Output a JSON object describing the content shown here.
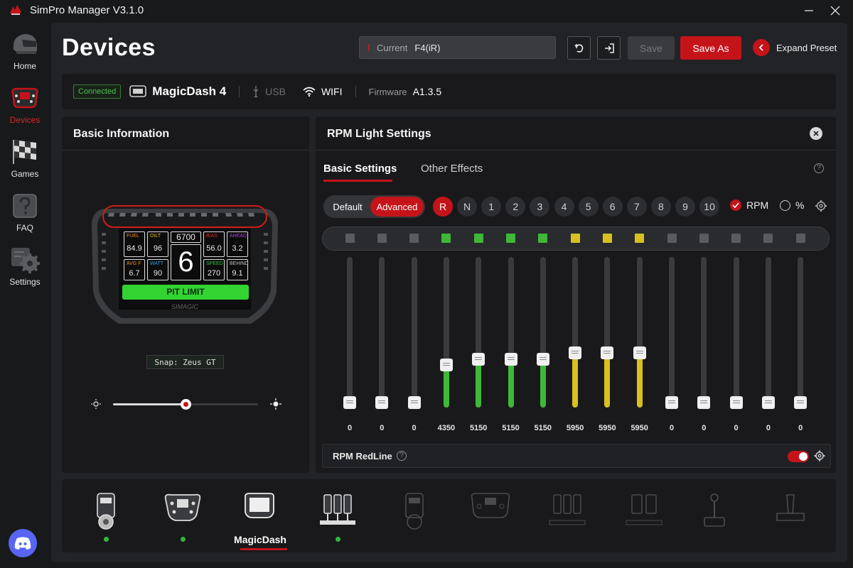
{
  "app": {
    "title": "SimPro Manager V3.1.0"
  },
  "sidebar": {
    "items": [
      {
        "label": "Home",
        "icon": "helmet-icon"
      },
      {
        "label": "Devices",
        "icon": "steering-wheel-icon"
      },
      {
        "label": "Games",
        "icon": "checkered-flag-icon"
      },
      {
        "label": "FAQ",
        "icon": "question-icon"
      },
      {
        "label": "Settings",
        "icon": "gear-icon"
      }
    ]
  },
  "header": {
    "title": "Devices",
    "preset_label": "Current",
    "preset_value": "F4(iR)",
    "save_label": "Save",
    "save_as_label": "Save As",
    "expand_label": "Expand Preset"
  },
  "device": {
    "status": "Connected",
    "name": "MagicDash 4",
    "usb": "USB",
    "wifi": "WIFI",
    "firmware_label": "Firmware",
    "firmware_value": "A1.3.5"
  },
  "basic_info": {
    "title": "Basic Information",
    "snap": "Snap: Zeus GT",
    "brightness": 0.5,
    "dash": {
      "rpm": "6700",
      "gear": "6",
      "pit": "PIT LIMIT",
      "brand": "SIMAGIC",
      "cells": [
        {
          "label": "FUEL",
          "value": "84.9",
          "color": "#e08a2a"
        },
        {
          "label": "OILT",
          "value": "96",
          "color": "#e0c020"
        },
        {
          "label": "BIAS",
          "value": "56.0",
          "color": "#d02a2a"
        },
        {
          "label": "AHEAD",
          "value": "3.2",
          "color": "#b040e0"
        },
        {
          "label": "AVG F",
          "value": "6.7",
          "color": "#e08a2a"
        },
        {
          "label": "WATT",
          "value": "90",
          "color": "#30a0e0"
        },
        {
          "label": "SPEED",
          "value": "270",
          "color": "#30c040"
        },
        {
          "label": "BEHIND",
          "value": "9.1",
          "color": "#c0c0c0"
        }
      ]
    }
  },
  "rpm_panel": {
    "title": "RPM Light Settings",
    "tabs": [
      "Basic Settings",
      "Other Effects"
    ],
    "mode": {
      "default_label": "Default",
      "advanced_label": "Advanced"
    },
    "gears": [
      "R",
      "N",
      "1",
      "2",
      "3",
      "4",
      "5",
      "6",
      "7",
      "8",
      "9",
      "10"
    ],
    "selected_gear": "R",
    "rpm_label": "RPM",
    "percent_label": "%",
    "leds": [
      {
        "value": "0",
        "color": "#5a5b5f"
      },
      {
        "value": "0",
        "color": "#5a5b5f"
      },
      {
        "value": "0",
        "color": "#5a5b5f"
      },
      {
        "value": "4350",
        "color": "#3fb83a"
      },
      {
        "value": "5150",
        "color": "#3fb83a"
      },
      {
        "value": "5150",
        "color": "#3fb83a"
      },
      {
        "value": "5150",
        "color": "#3fb83a"
      },
      {
        "value": "5950",
        "color": "#d8c020"
      },
      {
        "value": "5950",
        "color": "#d8c020"
      },
      {
        "value": "5950",
        "color": "#d8c020"
      },
      {
        "value": "0",
        "color": "#5a5b5f"
      },
      {
        "value": "0",
        "color": "#5a5b5f"
      },
      {
        "value": "0",
        "color": "#5a5b5f"
      },
      {
        "value": "0",
        "color": "#5a5b5f"
      },
      {
        "value": "0",
        "color": "#5a5b5f"
      }
    ],
    "slider_levels": [
      0,
      0,
      0,
      0.25,
      0.29,
      0.29,
      0.29,
      0.33,
      0.33,
      0.33,
      0,
      0,
      0,
      0,
      0
    ],
    "redline_label": "RPM RedLine"
  },
  "dock": {
    "devices": [
      {
        "name": "wheelbase-icon",
        "connected": true
      },
      {
        "name": "steering-wheel-icon",
        "connected": true
      },
      {
        "name": "magicdash-icon",
        "label": "MagicDash",
        "active": true
      },
      {
        "name": "pedals-icon",
        "connected": true
      },
      {
        "name": "wheelbase-alt-icon"
      },
      {
        "name": "formula-wheel-icon"
      },
      {
        "name": "pedals-2-icon"
      },
      {
        "name": "pedals-3-icon"
      },
      {
        "name": "shifter-icon"
      },
      {
        "name": "handbrake-icon"
      }
    ]
  },
  "colors": {
    "accent": "#c4141a",
    "connected": "#2dba3a"
  }
}
